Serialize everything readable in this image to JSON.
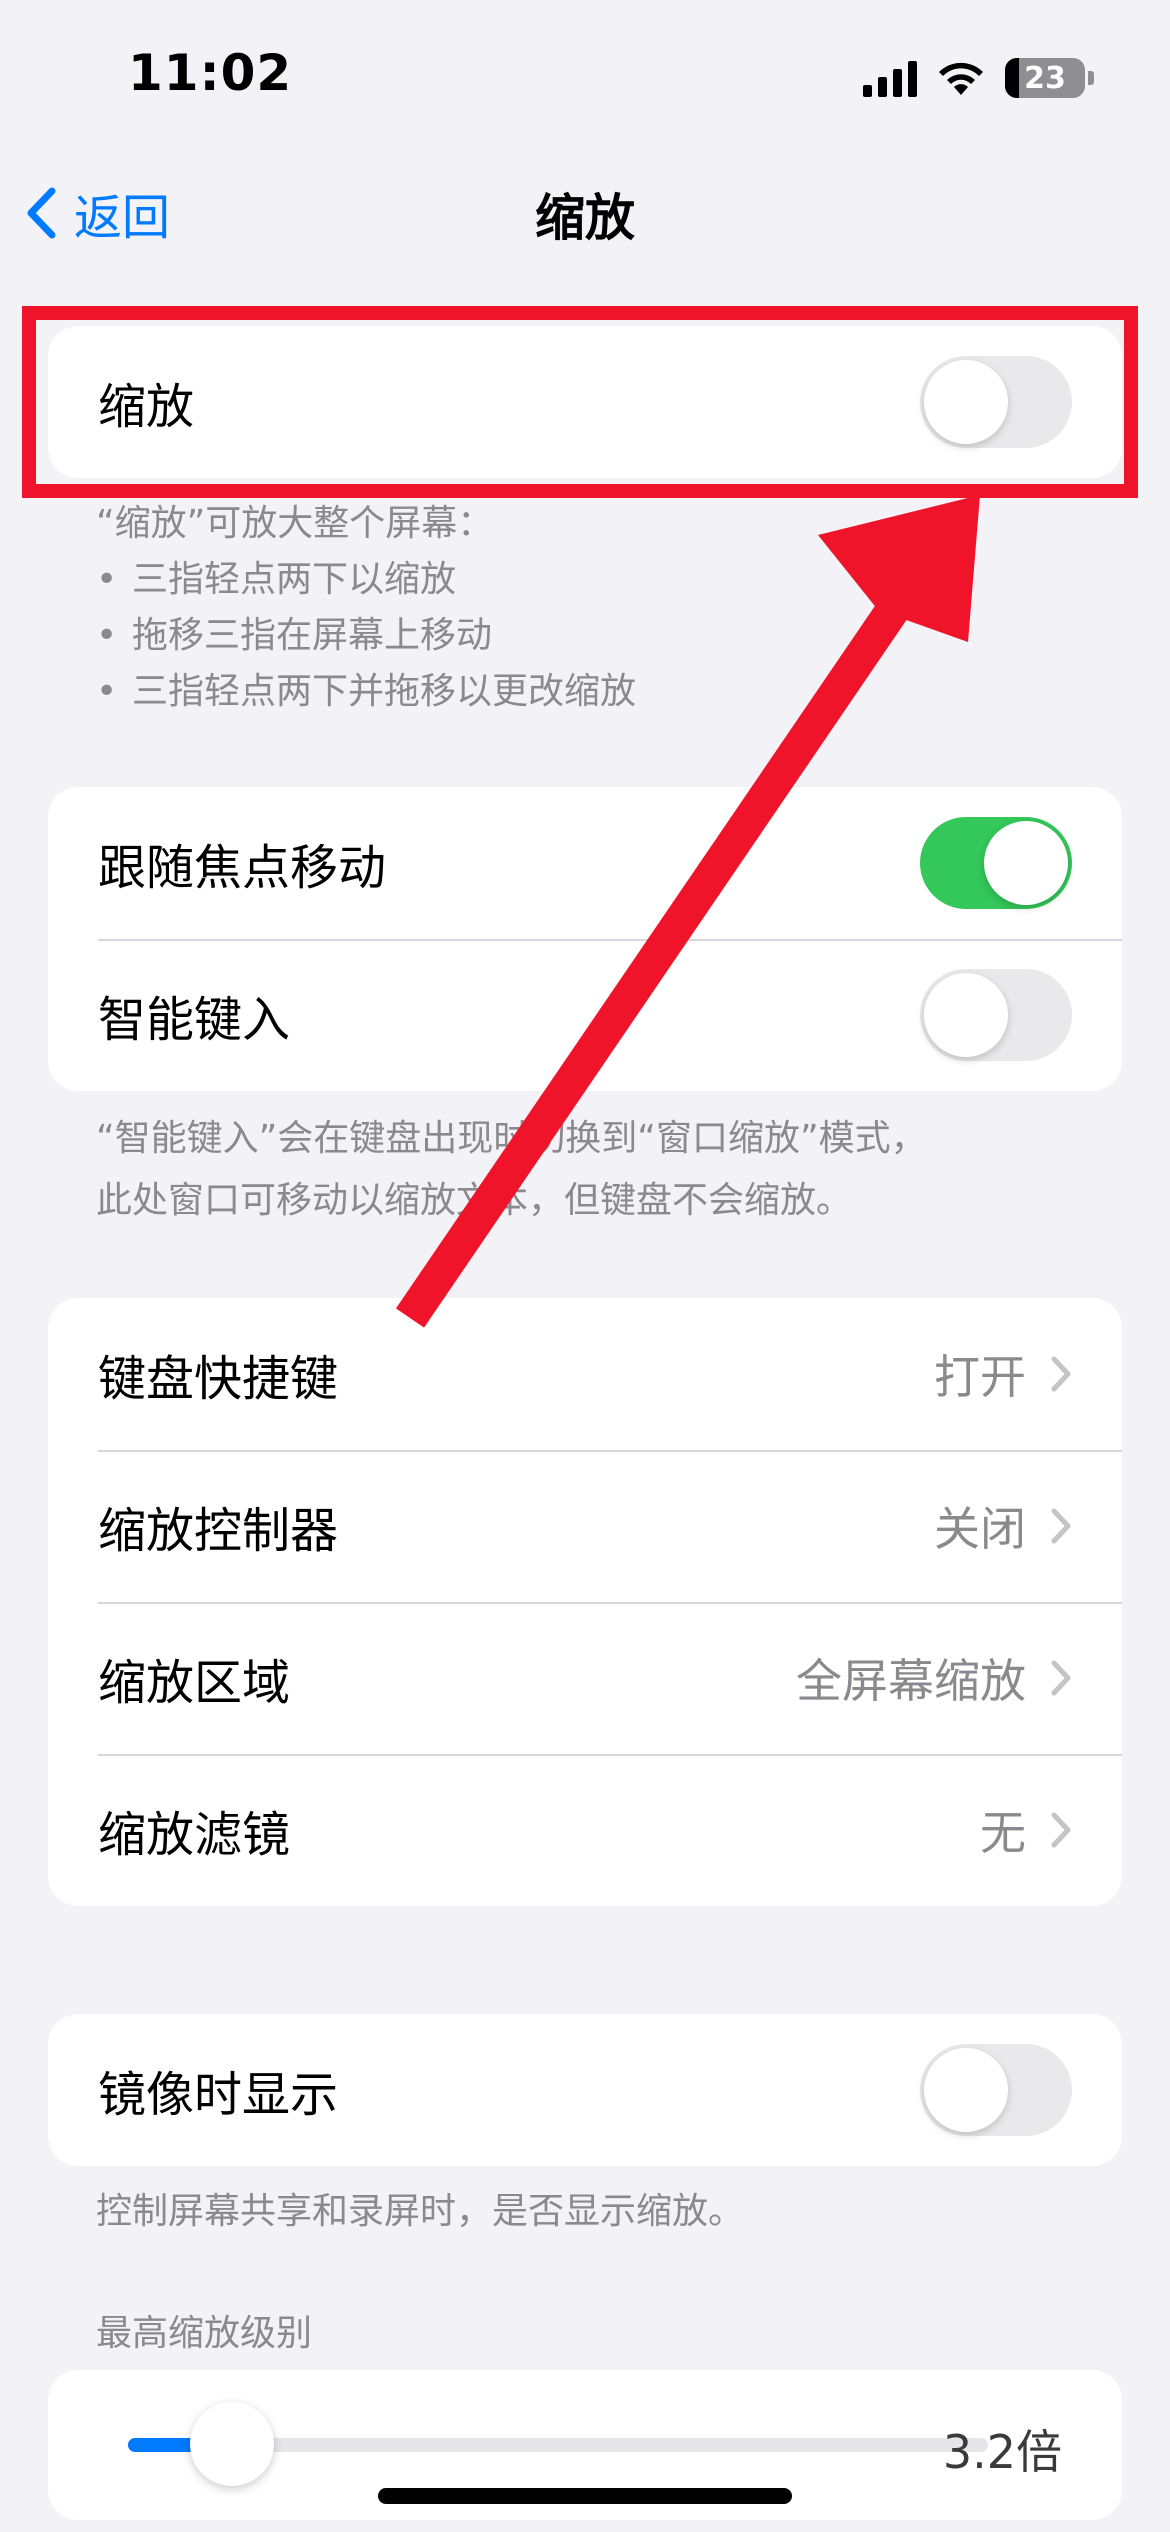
{
  "status_bar": {
    "time": "11:02",
    "battery": "23"
  },
  "nav": {
    "back_label": "返回",
    "title": "缩放"
  },
  "zoom_group": {
    "label": "缩放",
    "enabled": false
  },
  "zoom_footer": {
    "intro": "“缩放”可放大整个屏幕：",
    "bullets": [
      "三指轻点两下以缩放",
      "拖移三指在屏幕上移动",
      "三指轻点两下并拖移以更改缩放"
    ]
  },
  "focus_group": {
    "follow_focus": {
      "label": "跟随焦点移动",
      "enabled": true
    },
    "smart_typing": {
      "label": "智能键入",
      "enabled": false
    }
  },
  "focus_footer": {
    "line1": "“智能键入”会在键盘出现时切换到“窗口缩放”模式，",
    "line2": "此处窗口可移动以缩放文本，但键盘不会缩放。"
  },
  "options_group": {
    "keyboard_shortcuts": {
      "label": "键盘快捷键",
      "value": "打开"
    },
    "zoom_controller": {
      "label": "缩放控制器",
      "value": "关闭"
    },
    "zoom_region": {
      "label": "缩放区域",
      "value": "全屏幕缩放"
    },
    "zoom_filter": {
      "label": "缩放滤镜",
      "value": "无"
    }
  },
  "mirror_group": {
    "label": "镜像时显示",
    "enabled": false
  },
  "mirror_footer": "控制屏幕共享和录屏时，是否显示缩放。",
  "max_zoom": {
    "header": "最高缩放级别",
    "value": "3.2倍",
    "fraction": 0.1
  },
  "colors": {
    "accent": "#007aff",
    "toggle_on": "#34c759",
    "annotation": "#f0142a"
  }
}
